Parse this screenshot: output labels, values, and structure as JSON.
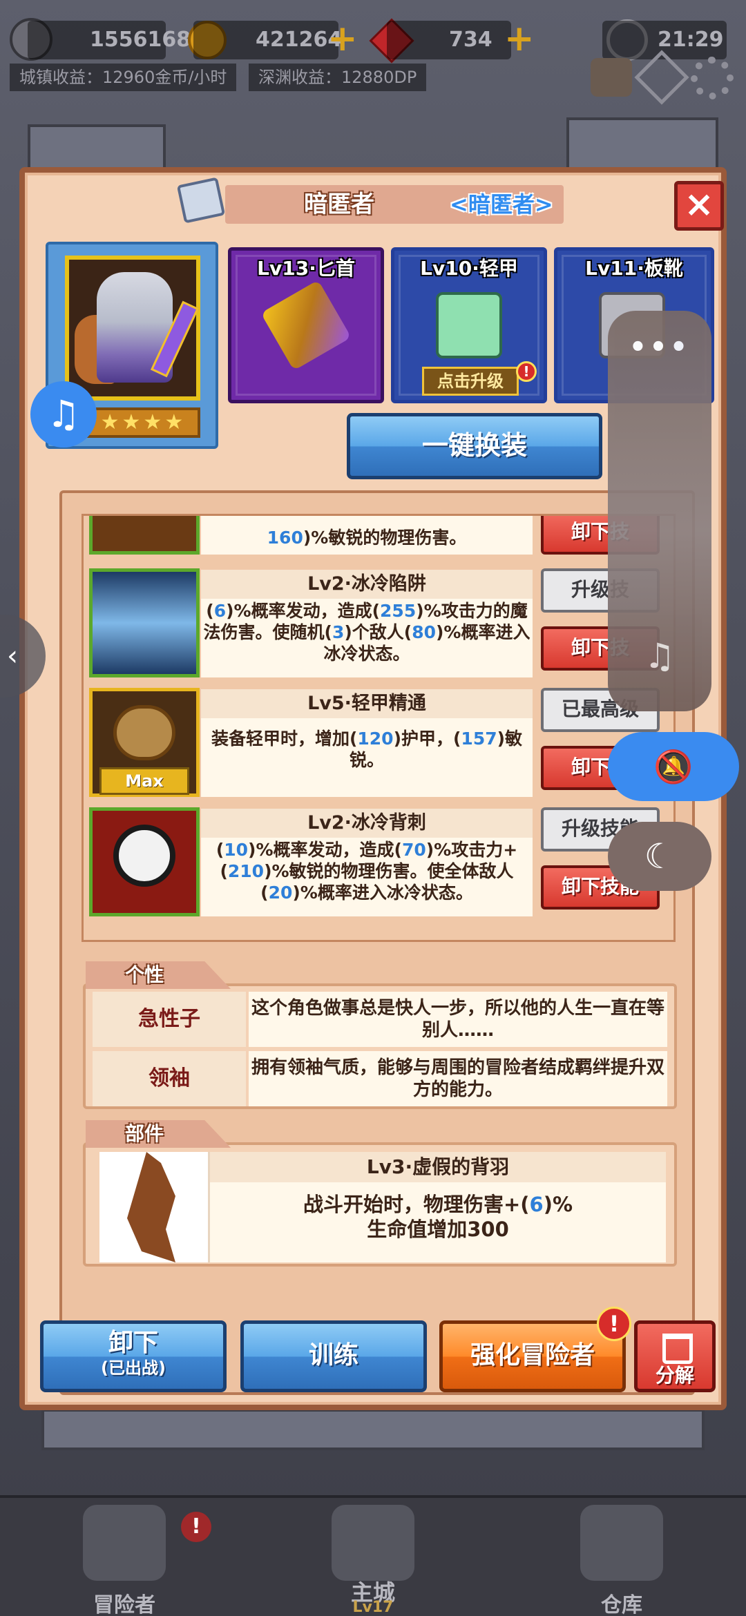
{
  "hud": {
    "power": "1556168",
    "gold": "421264",
    "gems": "734",
    "time": "21:29",
    "plus_gold": "+",
    "plus_gems": "+",
    "city_income": "城镇收益：12960金币/小时",
    "abyss_income": "深渊收益：12880DP"
  },
  "panel": {
    "title": "暗匿者",
    "class_tag": "<暗匿者>",
    "close": "×"
  },
  "hero": {
    "stars": "★★★★★"
  },
  "equipment": [
    {
      "name": "Lv13·匕首"
    },
    {
      "name": "Lv10·轻甲",
      "upgrade": "点击升级"
    },
    {
      "name": "Lv11·板靴"
    }
  ],
  "oneclick_label": "一键换装",
  "skills": [
    {
      "title": "",
      "desc_parts": [
        "",
        "160",
        ")%敏锐的物理伤害。"
      ],
      "buttons": {
        "remove": "卸下技"
      }
    },
    {
      "title": "Lv2·冰冷陷阱",
      "desc_html_parts": {
        "a": "(",
        "v1": "6",
        "b": ")%概率发动，造成(",
        "v2": "255",
        "c": ")%攻击力的魔法伤害。使随机(",
        "v3": "3",
        "d": ")个敌人(",
        "v4": "80",
        "e": ")%概率进入冰冷状态。"
      },
      "buttons": {
        "upgrade": "升级技",
        "remove": "卸下技"
      }
    },
    {
      "title": "Lv5·轻甲精通",
      "desc_html_parts": {
        "a": "装备轻甲时，增加(",
        "v1": "120",
        "b": ")护甲，(",
        "v2": "157",
        "c": ")敏锐。"
      },
      "max_label": "Max",
      "buttons": {
        "upgrade": "已最高级",
        "remove": "卸下技"
      }
    },
    {
      "title": "Lv2·冰冷背刺",
      "desc_html_parts": {
        "a": "(",
        "v1": "10",
        "b": ")%概率发动，造成(",
        "v2": "70",
        "c": ")%攻击力+(",
        "v3": "210",
        "d": ")%敏锐的物理伤害。使全体敌人(",
        "v4": "20",
        "e": ")%概率进入冰冷状态。"
      },
      "buttons": {
        "upgrade": "升级技能",
        "remove": "卸下技能"
      }
    }
  ],
  "traits": {
    "tab": "个性",
    "items": [
      {
        "name": "急性子",
        "desc": "这个角色做事总是快人一步，所以他的人生一直在等别人……"
      },
      {
        "name": "领袖",
        "desc": "拥有领袖气质，能够与周围的冒险者结成羁绊提升双方的能力。"
      }
    ]
  },
  "parts": {
    "tab": "部件",
    "title": "Lv3·虚假的背羽",
    "desc_a": "战斗开始时，物理伤害+(",
    "desc_v": "6",
    "desc_b": ")%",
    "desc_line2": "生命值增加300"
  },
  "bottom_buttons": {
    "unequip": "卸下",
    "unequip_sub": "(已出战)",
    "train": "训练",
    "enhance": "强化冒险者",
    "decompose": "分解"
  },
  "nav": {
    "adventurer": "冒险者",
    "main_city": "主城",
    "main_city_level": "Lv17",
    "warehouse": "仓库"
  },
  "overlay": {
    "dots": "•••"
  }
}
